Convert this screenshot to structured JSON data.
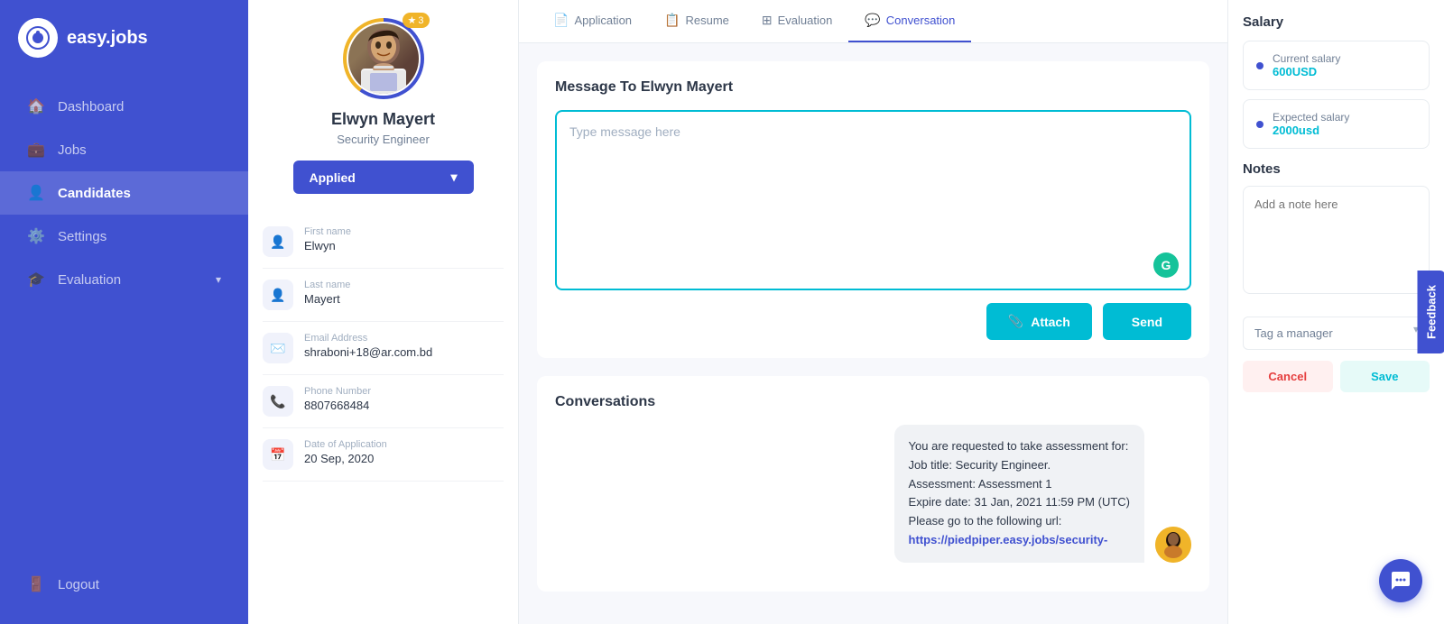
{
  "sidebar": {
    "logo_text": "easy.jobs",
    "logo_symbol": "a",
    "items": [
      {
        "id": "dashboard",
        "label": "Dashboard",
        "icon": "🏠"
      },
      {
        "id": "jobs",
        "label": "Jobs",
        "icon": "💼"
      },
      {
        "id": "candidates",
        "label": "Candidates",
        "icon": "👤",
        "active": true
      },
      {
        "id": "settings",
        "label": "Settings",
        "icon": "⚙️"
      },
      {
        "id": "evaluation",
        "label": "Evaluation",
        "icon": "🎓",
        "has_arrow": true
      }
    ],
    "logout_label": "Logout"
  },
  "profile": {
    "name": "Elwyn Mayert",
    "title": "Security Engineer",
    "status": "Applied",
    "star_count": "3",
    "fields": [
      {
        "label": "First name",
        "value": "Elwyn",
        "icon": "👤"
      },
      {
        "label": "Last name",
        "value": "Mayert",
        "icon": "👤"
      },
      {
        "label": "Email Address",
        "value": "shraboni+18@ar.com.bd",
        "icon": "✉️"
      },
      {
        "label": "Phone Number",
        "value": "8807668484",
        "icon": "📞"
      },
      {
        "label": "Date of Application",
        "value": "20 Sep, 2020",
        "icon": "📅"
      }
    ]
  },
  "tabs": [
    {
      "id": "application",
      "label": "Application",
      "icon": "📄"
    },
    {
      "id": "resume",
      "label": "Resume",
      "icon": "📋"
    },
    {
      "id": "evaluation",
      "label": "Evaluation",
      "icon": "⊞"
    },
    {
      "id": "conversation",
      "label": "Conversation",
      "icon": "💬",
      "active": true
    }
  ],
  "message": {
    "title": "Message To Elwyn Mayert",
    "placeholder": "Type message here",
    "attach_label": "Attach",
    "send_label": "Send"
  },
  "conversations": {
    "title": "Conversations",
    "messages": [
      {
        "text": "You are requested to take assessment for:\nJob title: Security Engineer.\nAssessment: Assessment 1\nExpire date: 31 Jan, 2021 11:59 PM (UTC)\nPlease go to the following url:\nhttps://piedpiper.easy.jobs/security-",
        "is_outgoing": true
      }
    ]
  },
  "salary": {
    "title": "Salary",
    "current_label": "Current salary",
    "current_value": "600USD",
    "expected_label": "Expected salary",
    "expected_value": "2000usd"
  },
  "notes": {
    "title": "Notes",
    "placeholder": "Add a note here",
    "tag_placeholder": "Tag a manager",
    "cancel_label": "Cancel",
    "save_label": "Save"
  },
  "feedback_tab": "Feedback"
}
